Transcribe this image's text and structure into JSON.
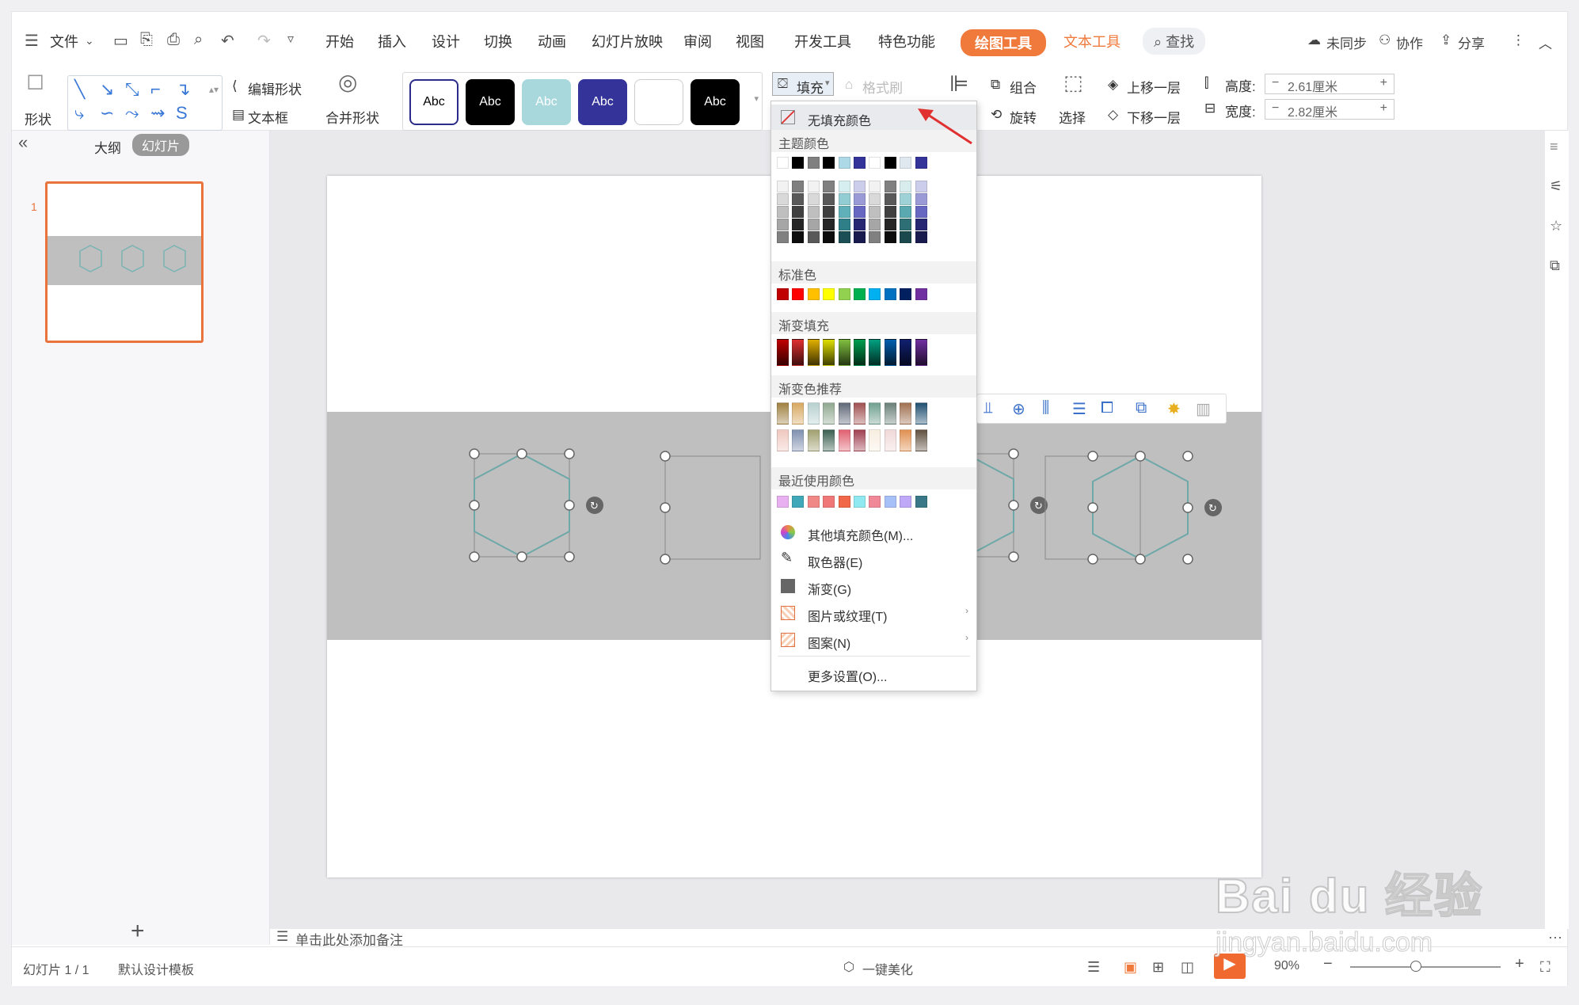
{
  "menubar": {
    "file": "文件",
    "tabs": [
      "开始",
      "插入",
      "设计",
      "切换",
      "动画",
      "幻灯片放映",
      "审阅",
      "视图",
      "开发工具",
      "特色功能"
    ],
    "active_tab": "绘图工具",
    "text_tab": "文本工具",
    "search": "查找",
    "sync": "未同步",
    "collab": "协作",
    "share": "分享"
  },
  "ribbon": {
    "shape": "形状",
    "edit_shape": "编辑形状",
    "textbox": "文本框",
    "merge_shape": "合并形状",
    "style_samples": [
      "Abc",
      "Abc",
      "Abc",
      "Abc",
      "",
      "Abc"
    ],
    "fill": "填充",
    "format_painter": "格式刷",
    "group": "组合",
    "rotate": "旋转",
    "select": "选择",
    "bring_forward": "上移一层",
    "send_backward": "下移一层",
    "height_label": "高度:",
    "height_value": "2.61厘米",
    "width_label": "宽度:",
    "width_value": "2.82厘米"
  },
  "sidebar": {
    "outline_tab": "大纲",
    "slides_tab": "幻灯片",
    "slide_number": "1"
  },
  "fill_menu": {
    "no_fill": "无填充颜色",
    "theme_colors": "主题颜色",
    "standard_colors": "标准色",
    "gradient_fill": "渐变填充",
    "gradient_recommend": "渐变色推荐",
    "recent_colors": "最近使用颜色",
    "more_colors": "其他填充颜色(M)...",
    "eyedropper": "取色器(E)",
    "gradient": "渐变(G)",
    "picture_texture": "图片或纹理(T)",
    "pattern": "图案(N)",
    "more_settings": "更多设置(O)...",
    "theme_top": [
      "#ffffff",
      "#000000",
      "#808080",
      "#000000",
      "#add8e6",
      "#333399",
      "#ffffff",
      "#000000",
      "#e0e8ef",
      "#333399"
    ],
    "theme_shades": [
      [
        "#f2f2f2",
        "#7f7f7f",
        "#f2f2f2",
        "#808080",
        "#d6eef0",
        "#cccceb",
        "#f2f2f2",
        "#808080",
        "#d8ecee",
        "#cccceb"
      ],
      [
        "#d9d9d9",
        "#595959",
        "#d9d9d9",
        "#595959",
        "#92cdd3",
        "#9a9ad7",
        "#d9d9d9",
        "#595959",
        "#9fd2d6",
        "#9a9ad7"
      ],
      [
        "#bfbfbf",
        "#404040",
        "#bfbfbf",
        "#404040",
        "#5fb0b8",
        "#6767c2",
        "#bfbfbf",
        "#404040",
        "#5aa9b0",
        "#6767c2"
      ],
      [
        "#a6a6a6",
        "#262626",
        "#a6a6a6",
        "#262626",
        "#2f7f88",
        "#262673",
        "#a6a6a6",
        "#262626",
        "#2e6e75",
        "#262673"
      ],
      [
        "#808080",
        "#0d0d0d",
        "#595959",
        "#0d0d0d",
        "#1c4f55",
        "#191a4d",
        "#808080",
        "#0d0d0d",
        "#1b484c",
        "#191a4d"
      ]
    ],
    "standard": [
      "#c00000",
      "#ff0000",
      "#ffc000",
      "#ffff00",
      "#92d050",
      "#00b050",
      "#00b0f0",
      "#0070c0",
      "#002060",
      "#7030a0"
    ],
    "gradients": [
      "#c00000",
      "#e03030",
      "#e0b000",
      "#e0e000",
      "#80c040",
      "#00a050",
      "#00a080",
      "#0060b0",
      "#102070",
      "#7030a0"
    ],
    "grad_recommend_1": [
      "#a08040",
      "#d8a860",
      "#b8d0d0",
      "#90a890",
      "#606878",
      "#a05050",
      "#70a090",
      "#6a8078",
      "#a07050",
      "#205070"
    ],
    "grad_recommend_2": [
      "#f0c8c0",
      "#8090b0",
      "#a0a070",
      "#3a6050",
      "#e06070",
      "#a04050",
      "#f8eee0",
      "#f0d8d8",
      "#e09050",
      "#605040"
    ],
    "recent": [
      "#e8b0f0",
      "#40a8b8",
      "#f08888",
      "#f07878",
      "#f06848",
      "#90e8f0",
      "#f08898",
      "#a8c0f8",
      "#c0a8f8",
      "#3a7888"
    ]
  },
  "notes": "单击此处添加备注",
  "status": {
    "slide_count": "幻灯片 1 / 1",
    "template": "默认设计模板",
    "beautify": "一键美化",
    "zoom": "90%"
  }
}
